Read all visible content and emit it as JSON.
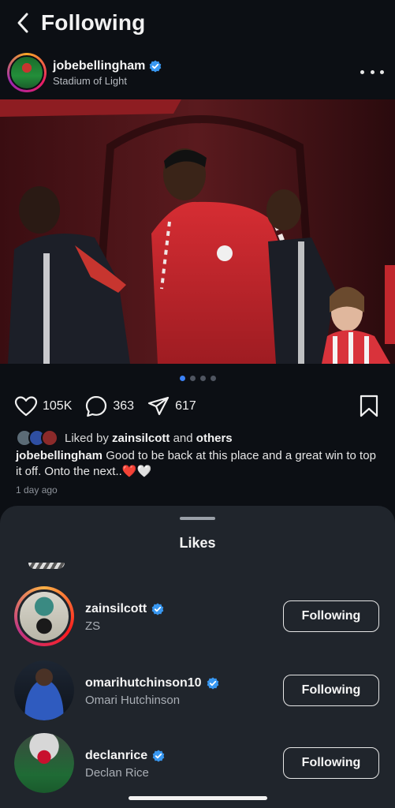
{
  "nav": {
    "title": "Following"
  },
  "post": {
    "username": "jobebellingham",
    "location": "Stadium of Light",
    "carousel_index": 1,
    "carousel_count": 4,
    "likes": "105K",
    "comments": "363",
    "shares": "617",
    "liked_by_prefix": "Liked by",
    "liked_by_user": "zainsilcott",
    "liked_by_and": "and",
    "liked_by_others": "others",
    "caption_user": "jobebellingham",
    "caption_text": "Good to be back at this place and a great win to top it off. Onto the next..",
    "caption_emojis": "❤️🤍",
    "time_ago": "1 day ago"
  },
  "likes_sheet": {
    "title": "Likes",
    "users": [
      {
        "username": "zainsilcott",
        "fullname": "ZS",
        "verified": true,
        "story_ring": true,
        "button": "Following"
      },
      {
        "username": "omarihutchinson10",
        "fullname": "Omari Hutchinson",
        "verified": true,
        "story_ring": false,
        "button": "Following"
      },
      {
        "username": "declanrice",
        "fullname": "Declan Rice",
        "verified": true,
        "story_ring": false,
        "button": "Following"
      }
    ]
  },
  "icons": {
    "back": "chevron-left-icon",
    "more": "ellipsis-icon",
    "verified": "verified-badge-icon",
    "like": "heart-icon",
    "comment": "comment-bubble-icon",
    "share": "paper-plane-icon",
    "bookmark": "bookmark-icon"
  },
  "colors": {
    "verified": "#3897f0",
    "active_dot": "#3b82f6",
    "sheet_bg": "#20252c",
    "bg": "#0c0f14"
  }
}
